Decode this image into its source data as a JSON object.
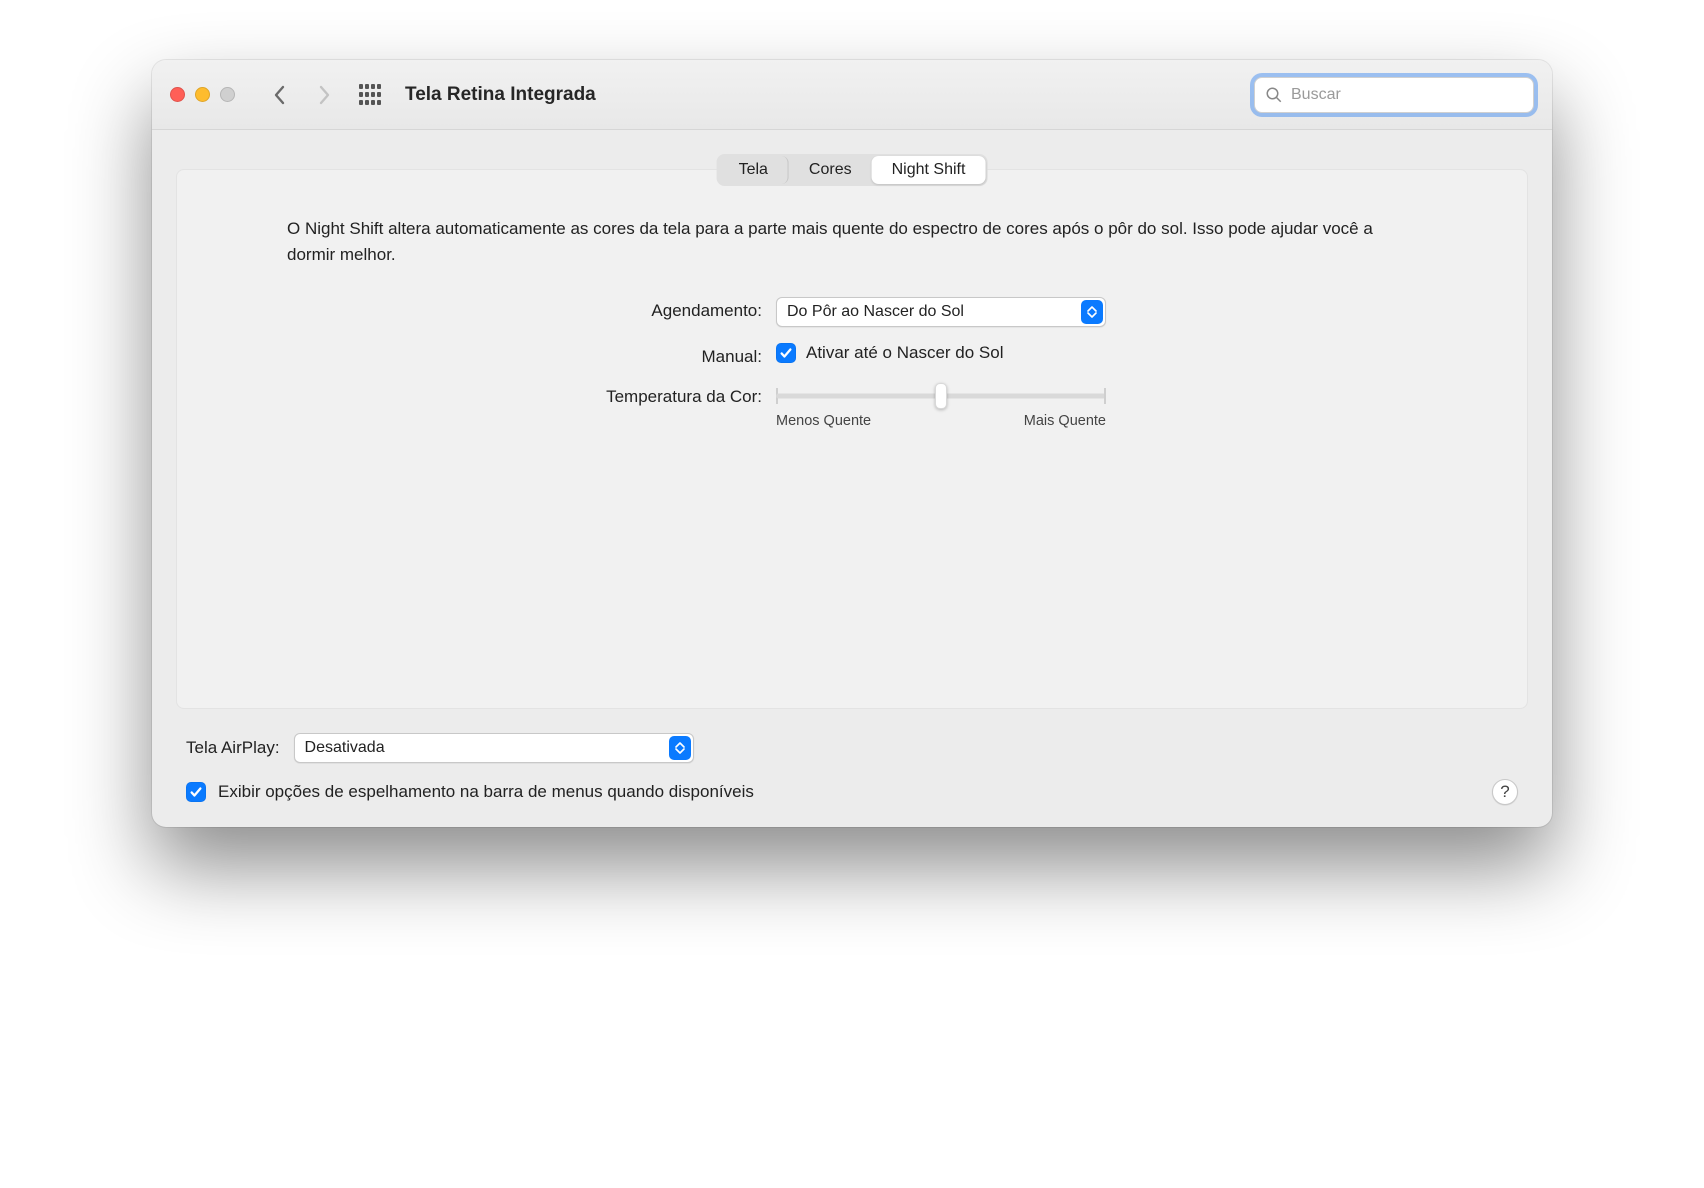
{
  "toolbar": {
    "title": "Tela Retina Integrada",
    "search_placeholder": "Buscar"
  },
  "tabs": {
    "items": [
      "Tela",
      "Cores",
      "Night Shift"
    ],
    "active_index": 2
  },
  "nightshift": {
    "description": "O Night Shift altera automaticamente as cores da tela para a parte mais quente do espectro de cores após o pôr do sol. Isso pode ajudar você a dormir melhor.",
    "schedule_label": "Agendamento:",
    "schedule_value": "Do Pôr ao Nascer do Sol",
    "manual_label": "Manual:",
    "manual_checkbox_label": "Ativar até o Nascer do Sol",
    "manual_checked": true,
    "temperature_label": "Temperatura da Cor:",
    "slider_min_label": "Menos Quente",
    "slider_max_label": "Mais Quente",
    "slider_value_percent": 50
  },
  "airplay": {
    "label": "Tela AirPlay:",
    "value": "Desativada"
  },
  "mirror": {
    "checked": true,
    "label": "Exibir opções de espelhamento na barra de menus quando disponíveis"
  },
  "help_label": "?"
}
